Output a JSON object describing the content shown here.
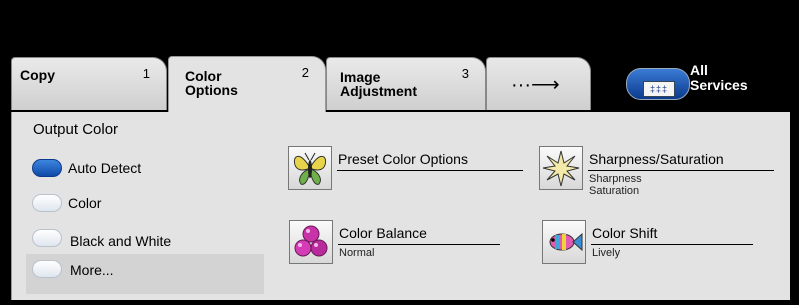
{
  "tabs": [
    {
      "label": "Copy",
      "number": "1"
    },
    {
      "label": "Color\nOptions",
      "number": "2"
    },
    {
      "label": "Image\nAdjustment",
      "number": "3"
    }
  ],
  "more_tabs_symbol": "···⟶",
  "all_services": {
    "label": "All\nServices",
    "icon_glyph": "‡‡‡"
  },
  "output_color": {
    "title": "Output Color",
    "options": [
      {
        "label": "Auto Detect",
        "selected": true
      },
      {
        "label": "Color",
        "selected": false
      },
      {
        "label": "Black and White",
        "selected": false
      },
      {
        "label": "More...",
        "selected": false
      }
    ]
  },
  "features": {
    "preset": {
      "title": "Preset Color Options",
      "subtitle": "",
      "icon": "butterfly-icon"
    },
    "balance": {
      "title": "Color Balance",
      "subtitle": "Normal",
      "icon": "color-balls-icon"
    },
    "sharpness": {
      "title": "Sharpness/Saturation",
      "subtitle": "Sharpness\nSaturation",
      "icon": "starburst-icon"
    },
    "shift": {
      "title": "Color Shift",
      "subtitle": "Lively",
      "icon": "fish-icon"
    }
  },
  "colors": {
    "selected_radio": "#1f5fc4",
    "panel_bg": "#e3e3e3",
    "top_bar": "#000000"
  }
}
